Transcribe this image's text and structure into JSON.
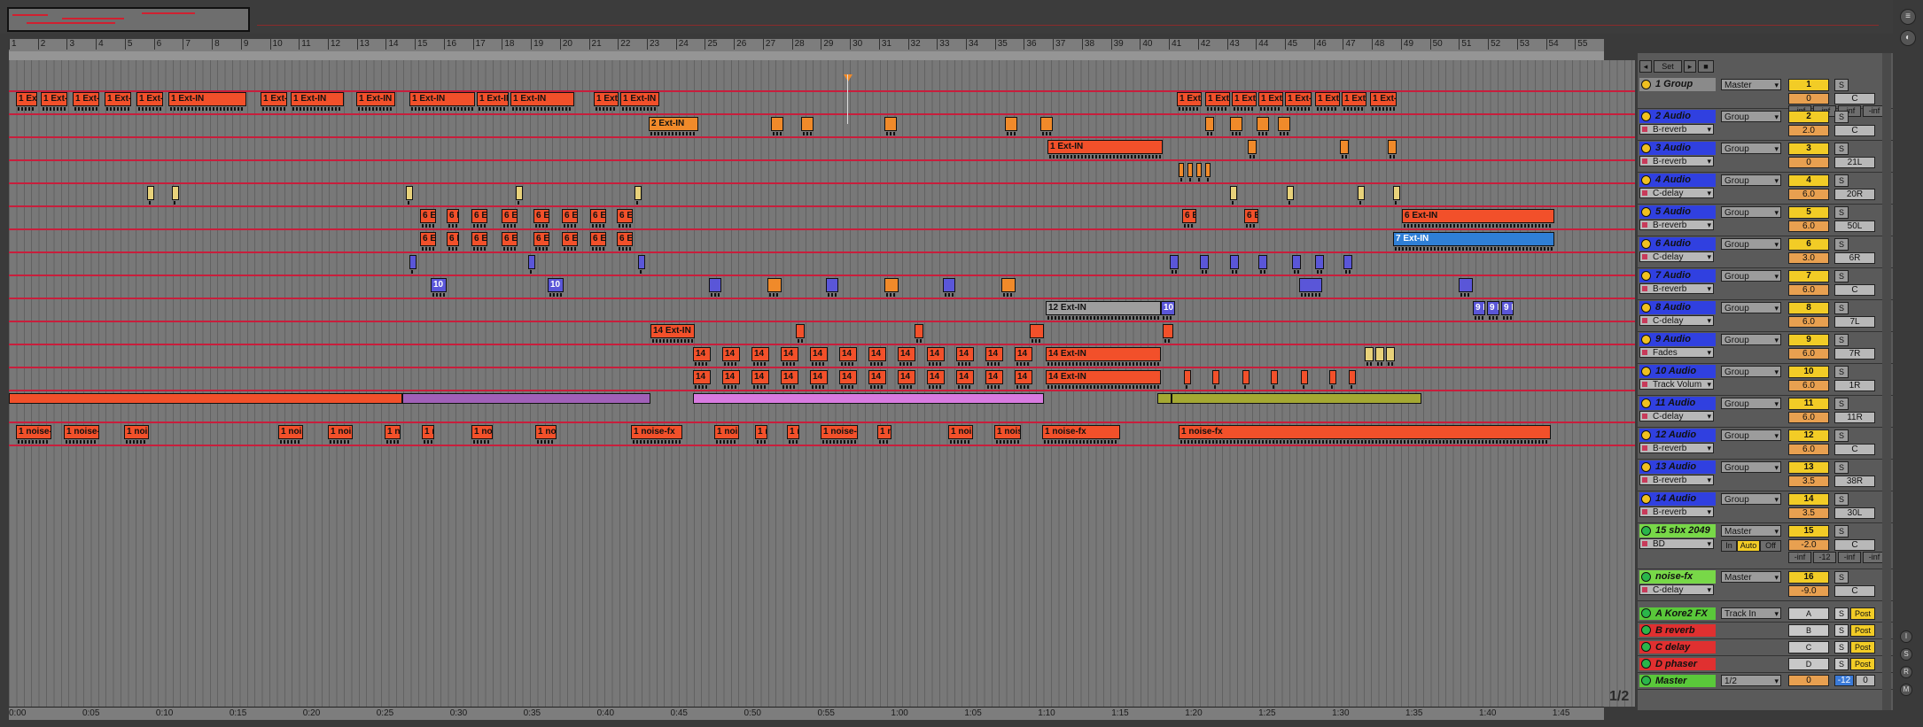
{
  "ruler_bars": [
    "1",
    "2",
    "3",
    "4",
    "5",
    "6",
    "7",
    "8",
    "9",
    "10",
    "11",
    "12",
    "13",
    "14",
    "15",
    "16",
    "17",
    "18",
    "19",
    "20",
    "21",
    "22",
    "23",
    "24",
    "25",
    "26",
    "27",
    "28",
    "29",
    "30",
    "31",
    "32",
    "33",
    "34",
    "35",
    "36",
    "37",
    "38",
    "39",
    "40",
    "41",
    "42",
    "43",
    "44",
    "45",
    "46",
    "47",
    "48",
    "49",
    "50",
    "51",
    "52",
    "53",
    "54",
    "55"
  ],
  "time_labels": [
    "0:00",
    "0:05",
    "0:10",
    "0:15",
    "0:20",
    "0:25",
    "0:30",
    "0:35",
    "0:40",
    "0:45",
    "0:50",
    "0:55",
    "1:00",
    "1:05",
    "1:10",
    "1:15",
    "1:20",
    "1:25",
    "1:30",
    "1:35",
    "1:40",
    "1:45"
  ],
  "mixer_header": {
    "set_label": "Set"
  },
  "page_fraction": "1/2",
  "tracks": [
    {
      "id": "t1",
      "name": "1 Group",
      "route": "Master",
      "num": "1",
      "vol": "0",
      "pan": "C",
      "extra": [
        "-inf",
        "-inf",
        "-inf",
        "-inf"
      ],
      "type": "group"
    },
    {
      "id": "t2",
      "name": "2 Audio",
      "route": "Group",
      "send": "B-reverb",
      "num": "2",
      "vol": "2.0",
      "pan": "C"
    },
    {
      "id": "t3",
      "name": "3 Audio",
      "route": "Group",
      "send": "B-reverb",
      "num": "3",
      "vol": "0",
      "pan": "21L"
    },
    {
      "id": "t4",
      "name": "4 Audio",
      "route": "Group",
      "send": "C-delay",
      "num": "4",
      "vol": "6.0",
      "pan": "20R"
    },
    {
      "id": "t5",
      "name": "5 Audio",
      "route": "Group",
      "send": "B-reverb",
      "num": "5",
      "vol": "6.0",
      "pan": "50L"
    },
    {
      "id": "t6",
      "name": "6 Audio",
      "route": "Group",
      "send": "C-delay",
      "num": "6",
      "vol": "3.0",
      "pan": "6R"
    },
    {
      "id": "t7",
      "name": "7 Audio",
      "route": "Group",
      "send": "B-reverb",
      "num": "7",
      "vol": "6.0",
      "pan": "C"
    },
    {
      "id": "t8",
      "name": "8 Audio",
      "route": "Group",
      "send": "C-delay",
      "num": "8",
      "vol": "6.0",
      "pan": "7L"
    },
    {
      "id": "t9",
      "name": "9 Audio",
      "route": "Group",
      "send": "Fades",
      "num": "9",
      "vol": "6.0",
      "pan": "7R"
    },
    {
      "id": "t10",
      "name": "10 Audio",
      "route": "Group",
      "send": "Track Volum",
      "num": "10",
      "vol": "6.0",
      "pan": "1R"
    },
    {
      "id": "t11",
      "name": "11 Audio",
      "route": "Group",
      "send": "C-delay",
      "num": "11",
      "vol": "6.0",
      "pan": "11R"
    },
    {
      "id": "t12",
      "name": "12 Audio",
      "route": "Group",
      "send": "B-reverb",
      "num": "12",
      "vol": "6.0",
      "pan": "C"
    },
    {
      "id": "t13",
      "name": "13 Audio",
      "route": "Group",
      "send": "B-reverb",
      "num": "13",
      "vol": "3.5",
      "pan": "38R"
    },
    {
      "id": "t14",
      "name": "14 Audio",
      "route": "Group",
      "send": "B-reverb",
      "num": "14",
      "vol": "3.5",
      "pan": "30L"
    },
    {
      "id": "t15",
      "name": "15 sbx 2049",
      "route": "Master",
      "send": "BD",
      "num": "15",
      "vol": "-2.0",
      "pan": "C",
      "extra": [
        "-inf",
        "-12",
        "-inf",
        "-inf"
      ],
      "inbtn": "In",
      "autobtn": "Auto",
      "offbtn": "Off",
      "type": "green"
    },
    {
      "id": "t16",
      "name": "noise-fx",
      "route": "Master",
      "send": "C-delay",
      "num": "16",
      "vol": "-9.0",
      "pan": "C",
      "type": "green"
    }
  ],
  "returns": [
    {
      "name": "A Kore2 FX",
      "route": "Track In",
      "letter": "A",
      "post": "Post",
      "type": "retgreen"
    },
    {
      "name": "B reverb",
      "letter": "B",
      "post": "Post",
      "type": "red"
    },
    {
      "name": "C delay",
      "letter": "C",
      "post": "Post",
      "type": "red"
    },
    {
      "name": "D phaser",
      "letter": "D",
      "post": "Post",
      "type": "red"
    }
  ],
  "master": {
    "name": "Master",
    "route": "1/2",
    "vol": "0",
    "pan": "-12",
    "pan2": "0"
  },
  "clips": {
    "ext_in": "1 Ext-IN",
    "ext_in_2": "2 Ext-IN",
    "ext_in_1b": "1 Ext-IN",
    "ext_in_6": "6 Ext-IN",
    "ext_in_7": "7 Ext-IN",
    "ext_in_12": "12 Ext-IN",
    "ext_in_14": "14 Ext-IN",
    "noise_fx": "1 noise-fx",
    "ten": "10",
    "six_e": "6 E",
    "fourteen": "14",
    "nine_e": "9 E"
  },
  "colors": {
    "lane_line": "#c81e3c",
    "ext_clip": "#f2502a",
    "group_track": "#3040e0",
    "return_red": "#e03030",
    "noise_green": "#78d848"
  }
}
